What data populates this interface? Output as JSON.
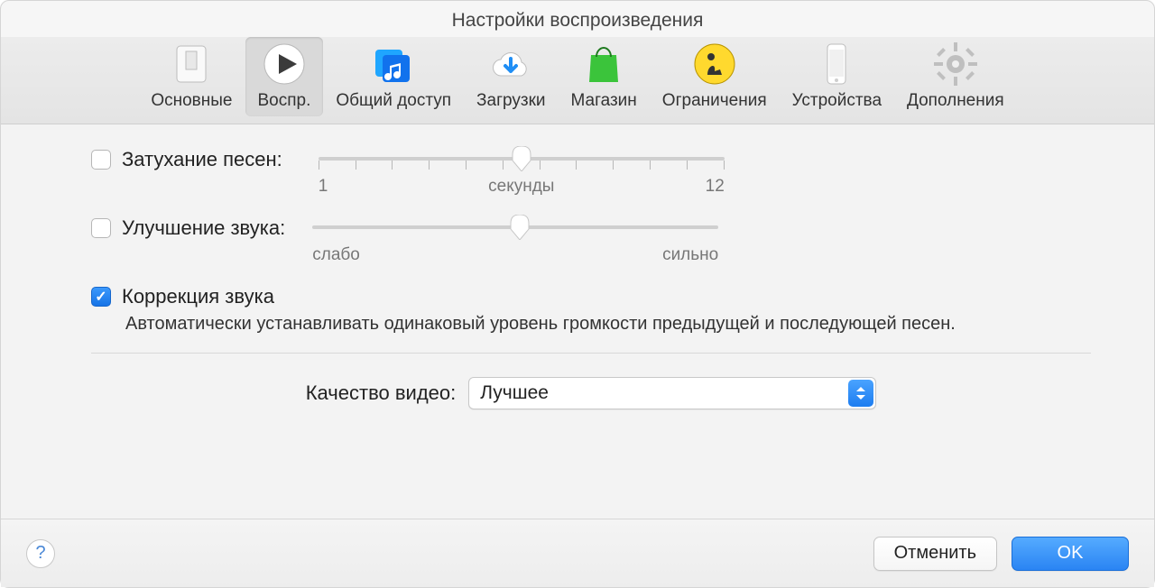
{
  "window": {
    "title": "Настройки воспроизведения"
  },
  "toolbar": {
    "items": [
      {
        "label": "Основные"
      },
      {
        "label": "Воспр."
      },
      {
        "label": "Общий доступ"
      },
      {
        "label": "Загрузки"
      },
      {
        "label": "Магазин"
      },
      {
        "label": "Ограничения"
      },
      {
        "label": "Устройства"
      },
      {
        "label": "Дополнения"
      }
    ],
    "selected_index": 1
  },
  "crossfade": {
    "label": "Затухание песен:",
    "checked": false,
    "min_label": "1",
    "center_label": "секунды",
    "max_label": "12",
    "value_percent": 50
  },
  "enhancer": {
    "label": "Улучшение звука:",
    "checked": false,
    "min_label": "слабо",
    "max_label": "сильно",
    "value_percent": 51
  },
  "sound_check": {
    "label": "Коррекция звука",
    "checked": true,
    "description": "Автоматически устанавливать одинаковый уровень громкости предыдущей и последующей песен."
  },
  "video": {
    "label": "Качество видео:",
    "value": "Лучшее"
  },
  "footer": {
    "help": "?",
    "cancel": "Отменить",
    "ok": "OK"
  }
}
